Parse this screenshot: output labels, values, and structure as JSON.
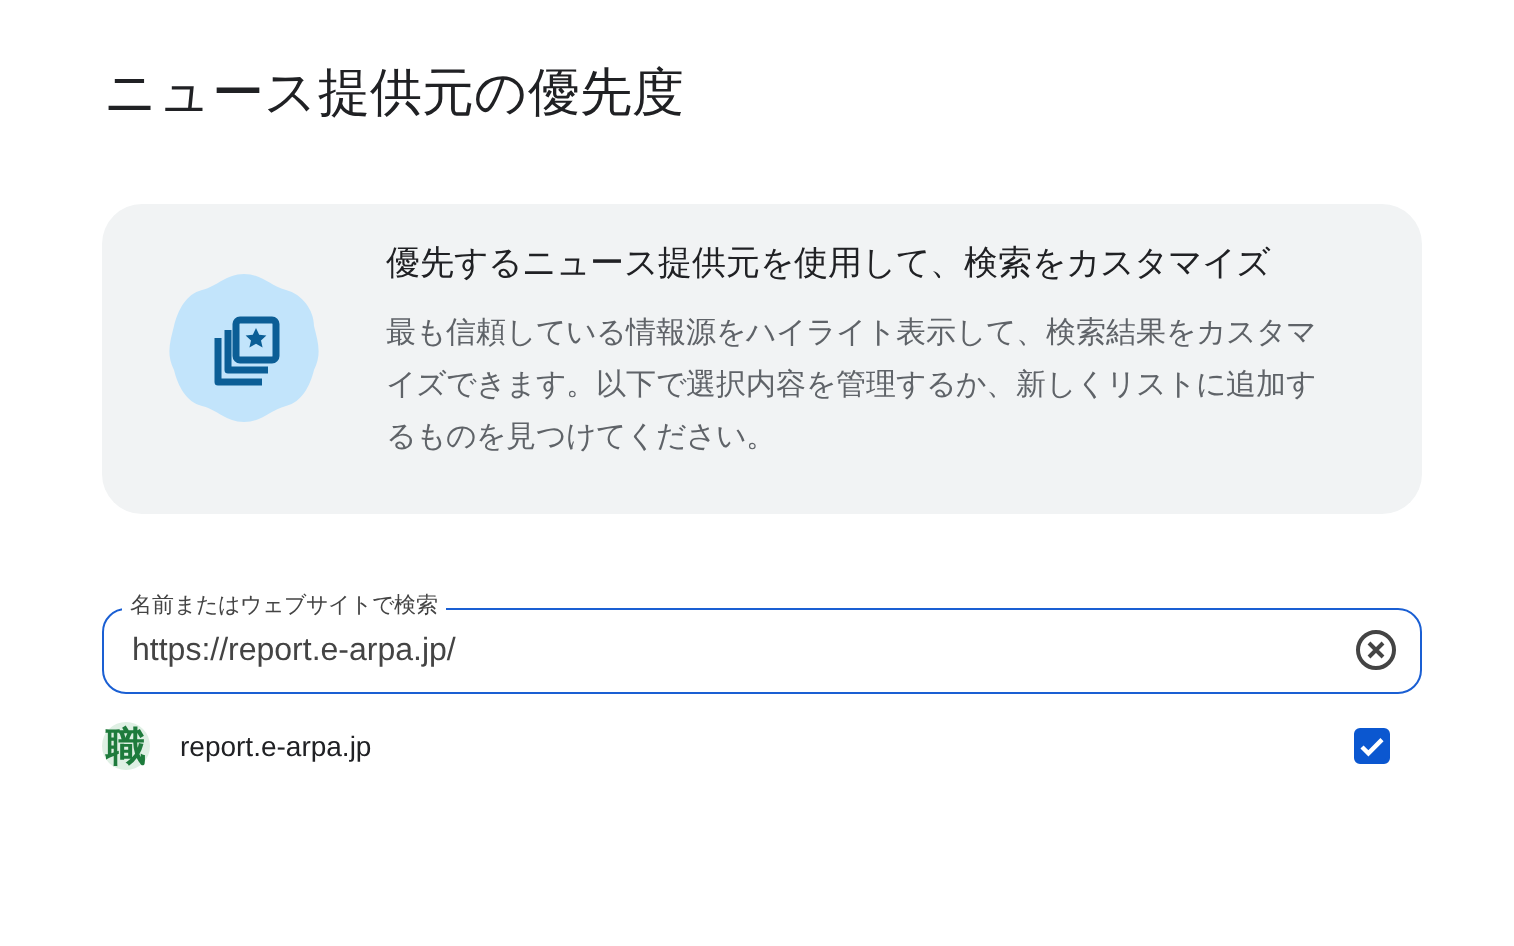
{
  "page": {
    "title": "ニュース提供元の優先度"
  },
  "info_card": {
    "heading": "優先するニュース提供元を使用して、検索をカスタマイズ",
    "body": "最も信頼している情報源をハイライト表示して、検索結果をカスタマイズできます。以下で選択内容を管理するか、新しくリストに追加するものを見つけてください。"
  },
  "search": {
    "label": "名前またはウェブサイトで検索",
    "value": "https://report.e-arpa.jp/"
  },
  "results": [
    {
      "icon_text": "職",
      "name": "report.e-arpa.jp",
      "checked": true
    }
  ]
}
